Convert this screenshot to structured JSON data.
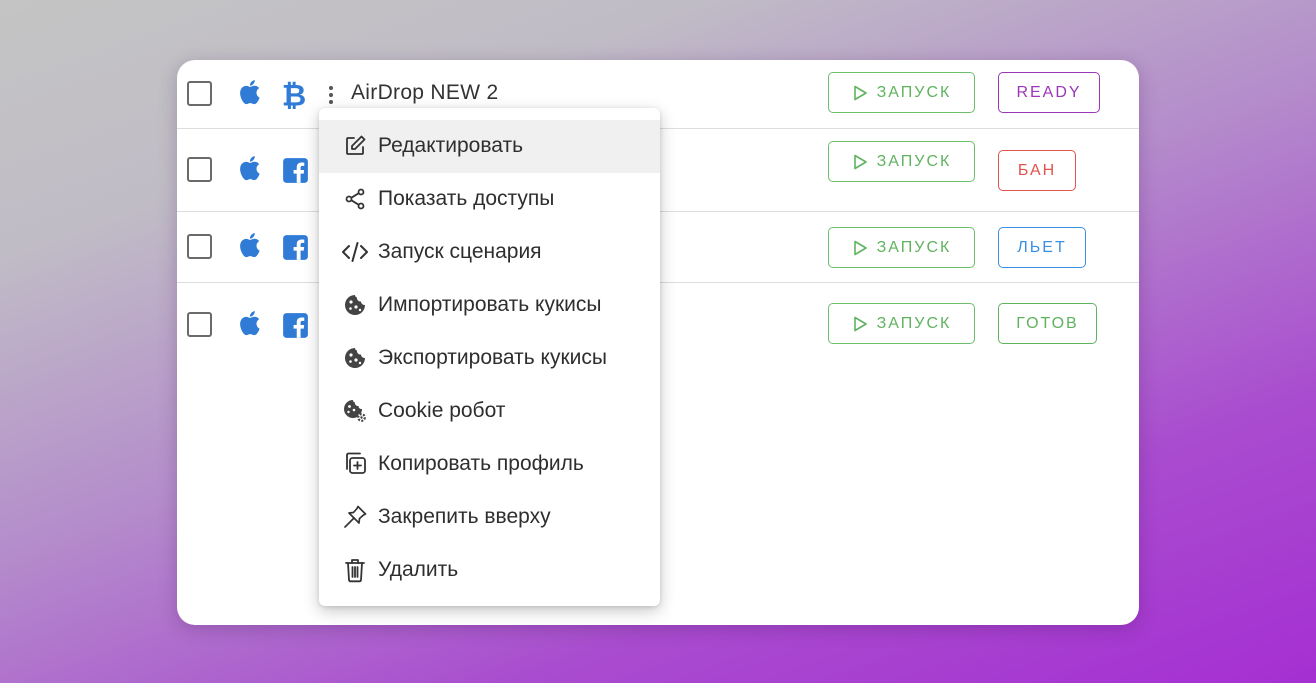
{
  "colors": {
    "apple_blue": "#2f7bd6",
    "bitcoin_blue": "#2f7bd6",
    "facebook_blue": "#2f7bd6",
    "launch_green": "#5fb35f",
    "status_ready": "#9c35b8",
    "status_ban": "#e0544c",
    "status_flowing": "#3d8fe0",
    "status_done": "#5fb35f"
  },
  "profiles": [
    {
      "os_icon": "apple-icon",
      "type_icon": "bitcoin-icon",
      "name": "AirDrop NEW 2",
      "launch_label": "ЗАПУСК",
      "status": "READY"
    },
    {
      "os_icon": "apple-icon",
      "type_icon": "facebook-icon",
      "name": "",
      "launch_label": "ЗАПУСК",
      "status": "БАН"
    },
    {
      "os_icon": "apple-icon",
      "type_icon": "facebook-icon",
      "name": "",
      "launch_label": "ЗАПУСК",
      "status": "ЛЬЕТ"
    },
    {
      "os_icon": "apple-icon",
      "type_icon": "facebook-icon",
      "name": "",
      "launch_label": "ЗАПУСК",
      "status": "ГОТОВ"
    }
  ],
  "context_menu": {
    "items": [
      {
        "label": "Редактировать",
        "icon": "edit-icon"
      },
      {
        "label": "Показать доступы",
        "icon": "share-icon"
      },
      {
        "label": "Запуск сценария",
        "icon": "code-icon"
      },
      {
        "label": "Импортировать кукисы",
        "icon": "cookie-icon"
      },
      {
        "label": "Экспортировать кукисы",
        "icon": "cookie-icon"
      },
      {
        "label": "Cookie робот",
        "icon": "cookie-gear-icon"
      },
      {
        "label": "Копировать профиль",
        "icon": "copy-plus-icon"
      },
      {
        "label": "Закрепить вверху",
        "icon": "pin-icon"
      },
      {
        "label": "Удалить",
        "icon": "trash-icon"
      }
    ]
  }
}
